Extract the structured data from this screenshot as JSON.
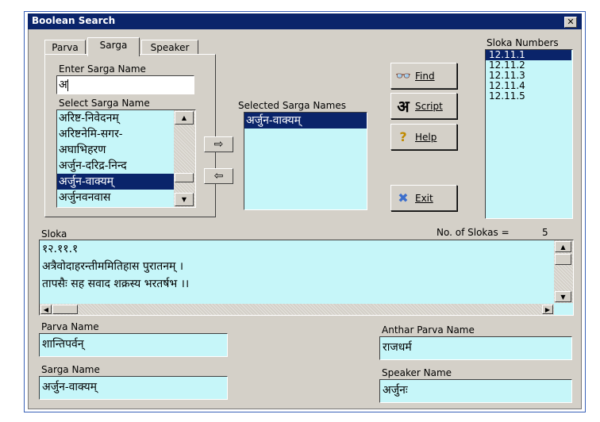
{
  "window": {
    "title": "Boolean Search",
    "close": "✕"
  },
  "tabs": [
    {
      "label": "Parva"
    },
    {
      "label": "Sarga"
    },
    {
      "label": "Speaker"
    }
  ],
  "sarga": {
    "enter_label": "Enter Sarga Name",
    "enter_value": "अ",
    "select_label": "Select Sarga Name",
    "items": [
      "अरिष्ट-निवेदनम्",
      "अरिष्टनेमि-सगर-",
      "अघाभिहरण",
      "अर्जुन-दरिद्र-निन्द",
      "अर्जुन-वाक्यम्",
      "अर्जुनवनवास"
    ],
    "selected_index": 4,
    "selected_label": "Selected Sarga Names",
    "selected_items": [
      "अर्जुन-वाक्यम्"
    ]
  },
  "transfer": {
    "add": "⇨",
    "remove": "⇦"
  },
  "buttons": {
    "find": {
      "label": "Find",
      "icon": "binoculars-icon",
      "glyph": "👓"
    },
    "script": {
      "label": "Script",
      "icon": "script-icon",
      "glyph": "अ"
    },
    "help": {
      "label": "Help",
      "icon": "help-icon",
      "glyph": "?"
    },
    "exit": {
      "label": "Exit",
      "icon": "exit-icon",
      "glyph": "✖"
    }
  },
  "sloka_numbers": {
    "label": "Sloka Numbers",
    "items": [
      "12.11.1",
      "12.11.2",
      "12.11.3",
      "12.11.4",
      "12.11.5"
    ],
    "selected_index": 0
  },
  "sloka": {
    "label": "Sloka",
    "count_label": "No. of Slokas =",
    "count_value": "5",
    "lines": [
      "१२.११.१",
      "अत्रैवोदाहरन्तीममितिहास पुरातनम् ।",
      "तापसैः सह सवाद शक्रस्य भरतर्षभ ।।"
    ]
  },
  "fields": {
    "parva_label": "Parva Name",
    "parva_value": "शान्तिपर्वन्",
    "anthar_label": "Anthar Parva Name",
    "anthar_value": "राजधर्म",
    "sarga_label": "Sarga Name",
    "sarga_value": "अर्जुन-वाक्यम्",
    "speaker_label": "Speaker Name",
    "speaker_value": "अर्जुनः"
  },
  "colors": {
    "title_bar": "#0a246a",
    "field_bg": "#c6f6f9",
    "selection": "#0a246a",
    "face": "#d4d0c8"
  }
}
